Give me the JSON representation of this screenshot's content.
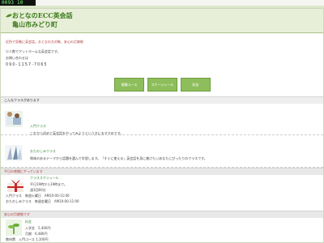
{
  "status_chip": "0093 10",
  "header": {
    "title_line1": "おとなのECC英会話",
    "title_line2": "亀山市みどり町"
  },
  "tagline": "近所で気軽に英会話。おとなの方対象、安心の月謝制",
  "intro": {
    "line1": "少人数でアットホームな英会話です。",
    "line2": "お問い合わせは",
    "phone": "090-1157-7065"
  },
  "nav": {
    "courses": "開講コース",
    "schedule": "スケージュール",
    "fees": "料金"
  },
  "sections": {
    "classes": "こんなクラスがあります",
    "weekday": "平日の夜間にやっています",
    "fees": "安心の月謝制です"
  },
  "courses": [
    {
      "title": "入門クラス",
      "desc": "これから初めて英会話をやってみようという方におすすめです。"
    },
    {
      "title": "おたのしみクラス",
      "desc": "興味のあるテーマから話題を選んで学習します。「すぐに使える」英会話を身に着けたいあなたにぴったりのクラスです。"
    }
  ],
  "schedule": {
    "title": "クラススケジュール",
    "line1": "平日19時から19時まで。",
    "line2": "週1回60分",
    "line3": "入門クラス　毎週火曜日　AM10:00-11:00",
    "line4": "おたのしみクラス　毎週金曜日　AM10:00-11:00"
  },
  "fees": {
    "title": "料金",
    "line1": "入学金　5,400円",
    "line2": "月謝　6,480円",
    "line3": "教材費　入門コース 1,100円"
  }
}
